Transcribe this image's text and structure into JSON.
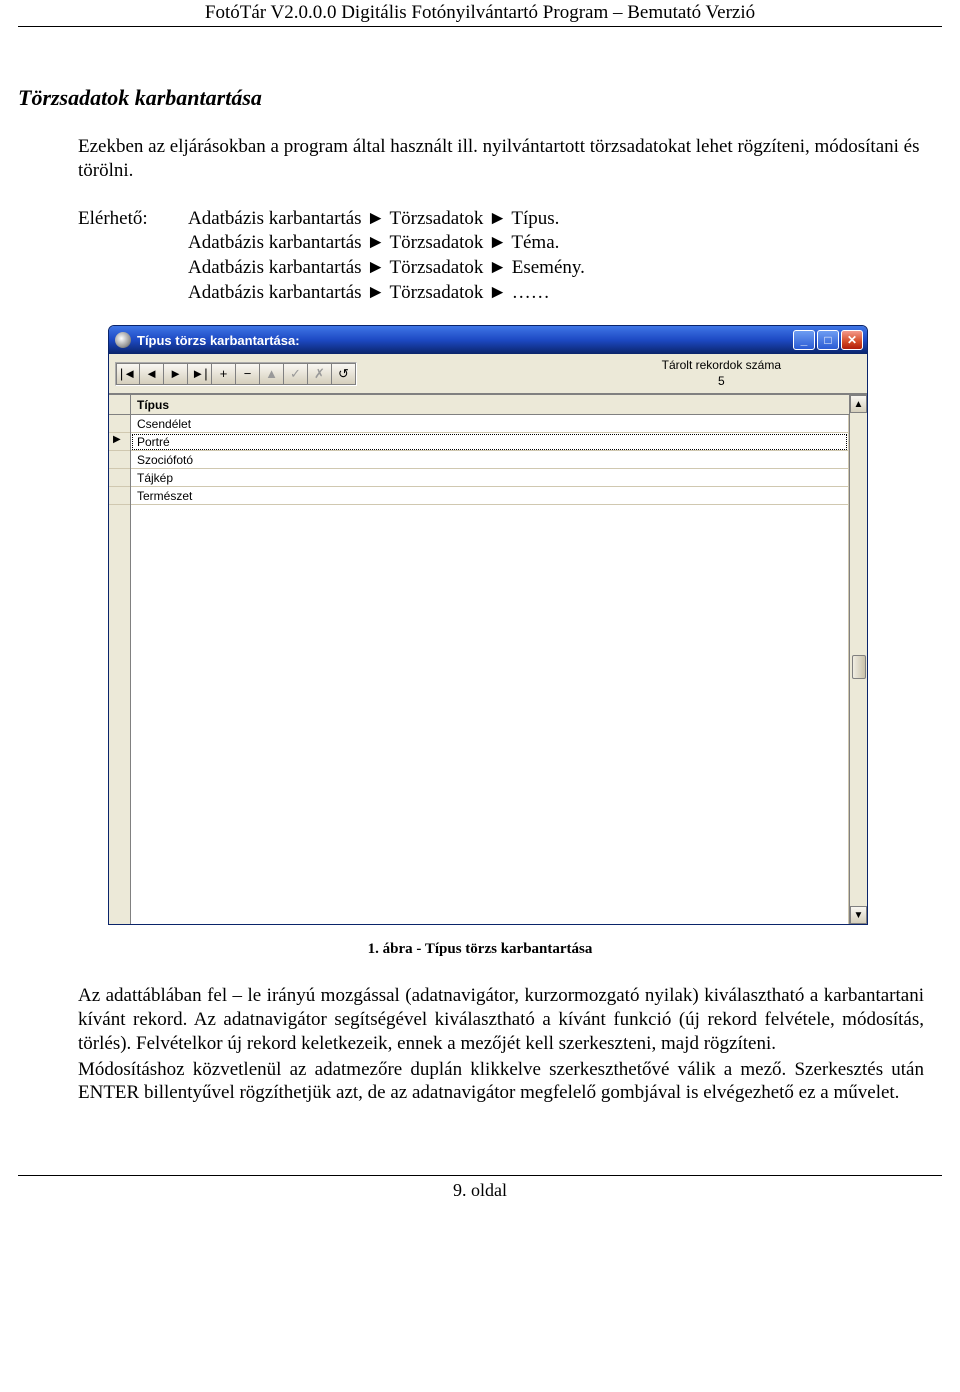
{
  "doc": {
    "header": "FotóTár V2.0.0.0 Digitális Fotónyilvántartó Program – Bemutató Verzió",
    "section_title": "Törzsadatok karbantartása",
    "intro": "Ezekben az eljárásokban a program által használt ill. nyilvántartott törzsadatokat lehet rögzíteni, módosítani és törölni.",
    "menu_label": "Elérhető:",
    "menu_lines": [
      "Adatbázis karbantartás ► Törzsadatok ► Típus.",
      "Adatbázis karbantartás ► Törzsadatok ► Téma.",
      "Adatbázis karbantartás ► Törzsadatok ► Esemény.",
      "Adatbázis karbantartás ► Törzsadatok ► ……"
    ],
    "caption": "1. ábra - Típus törzs karbantartása",
    "para1": "Az adattáblában fel – le irányú mozgással (adatnavigátor, kurzormozgató nyilak) kiválasztható a karbantartani kívánt rekord. Az adatnavigátor segítségével kiválasztható a kívánt funkció (új rekord felvétele, módosítás, törlés). Felvételkor új rekord keletkezeik, ennek a mezőjét kell szerkeszteni, majd rögzíteni.",
    "para2": "Módosításhoz közvetlenül az adatmezőre duplán klikkelve szerkeszthetővé válik a mező. Szerkesztés után ENTER billentyűvel rögzíthetjük azt, de az adatnavigátor megfelelő gombjával is elvégezhető ez a művelet.",
    "footer": "9. oldal"
  },
  "window": {
    "title": "Típus törzs karbantartása:",
    "toolbar": {
      "first": "|◄",
      "prev": "◄",
      "next": "►",
      "last": "►|",
      "add": "+",
      "remove": "−",
      "edit": "▲",
      "commit": "✓",
      "cancel": "✗",
      "refresh": "↺"
    },
    "record_label": "Tárolt rekordok száma",
    "record_count": "5",
    "column_header": "Típus",
    "rows": [
      "Csendélet",
      "Portré",
      "Szociófotó",
      "Tájkép",
      "Természet"
    ],
    "active_row_index": 1
  }
}
